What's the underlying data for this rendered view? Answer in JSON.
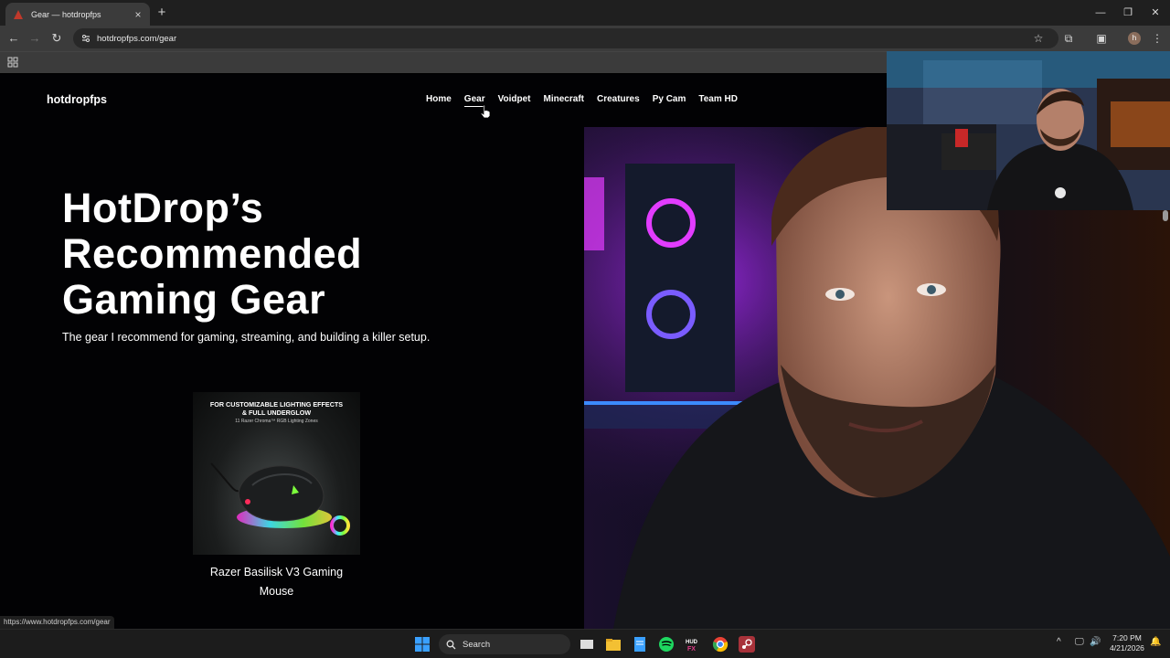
{
  "browser": {
    "tab_title": "Gear — hotdropfps",
    "new_tab": "+",
    "url": "hotdropfps.com/gear",
    "profile_initial": "h",
    "status_url": "https://www.hotdropfps.com/gear"
  },
  "site": {
    "logo": "hotdropfps",
    "nav": [
      {
        "label": "Home"
      },
      {
        "label": "Gear"
      },
      {
        "label": "Voidpet"
      },
      {
        "label": "Minecraft"
      },
      {
        "label": "Creatures"
      },
      {
        "label": "Py Cam"
      },
      {
        "label": "Team HD"
      }
    ],
    "hero": {
      "title_line1": "HotDrop’s",
      "title_line2": "Recommended",
      "title_line3": "Gaming Gear",
      "subtitle": "The gear I recommend for gaming, streaming, and building a killer setup."
    },
    "product": {
      "image_text_line1": "FOR CUSTOMIZABLE LIGHTING EFFECTS",
      "image_text_line2": "& FULL UNDERGLOW",
      "image_text_line3": "11 Razer Chroma™ RGB Lighting Zones",
      "name_line1": "Razer Basilisk V3 Gaming",
      "name_line2": "Mouse"
    }
  },
  "taskbar": {
    "search_label": "Search",
    "time": "7:20 PM",
    "date": "4/21/2026"
  },
  "colors": {
    "page_bg": "#020204",
    "chrome_bg": "#3b3b3b",
    "taskbar_bg": "#1c1c1c"
  }
}
